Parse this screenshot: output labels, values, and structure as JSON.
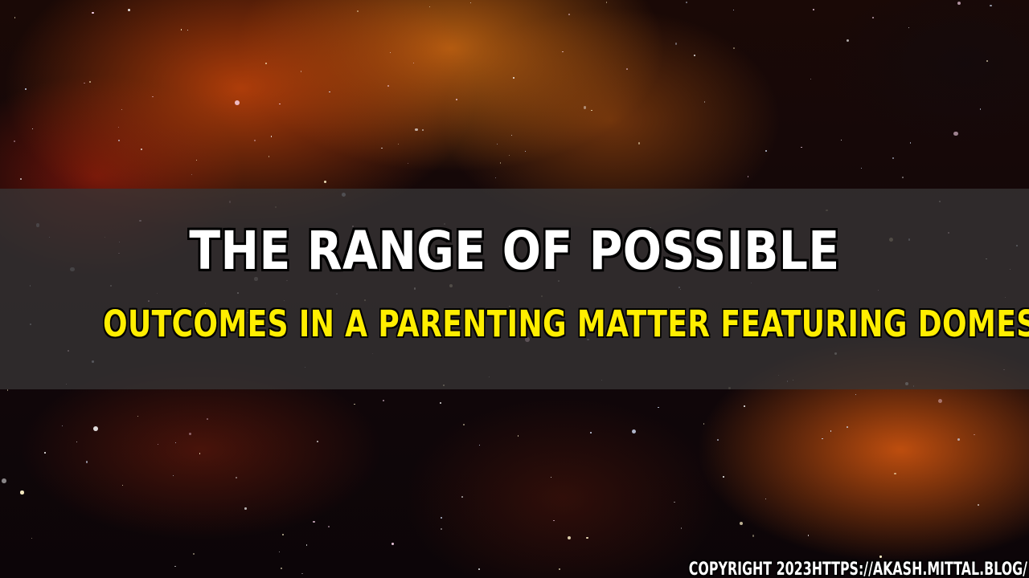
{
  "headline": {
    "line1": "THE RANGE OF POSSIBLE",
    "line2": "OUTCOMES IN A PARENTING MATTER FEATURING DOMESTIC VIOLENCE"
  },
  "footer": {
    "copyright": "COPYRIGHT 2023HTTPS://AKASH.MITTAL.BLOG/"
  },
  "colors": {
    "headline_line1": "#ffffff",
    "headline_line2": "#ffee00",
    "band": "#373434"
  }
}
